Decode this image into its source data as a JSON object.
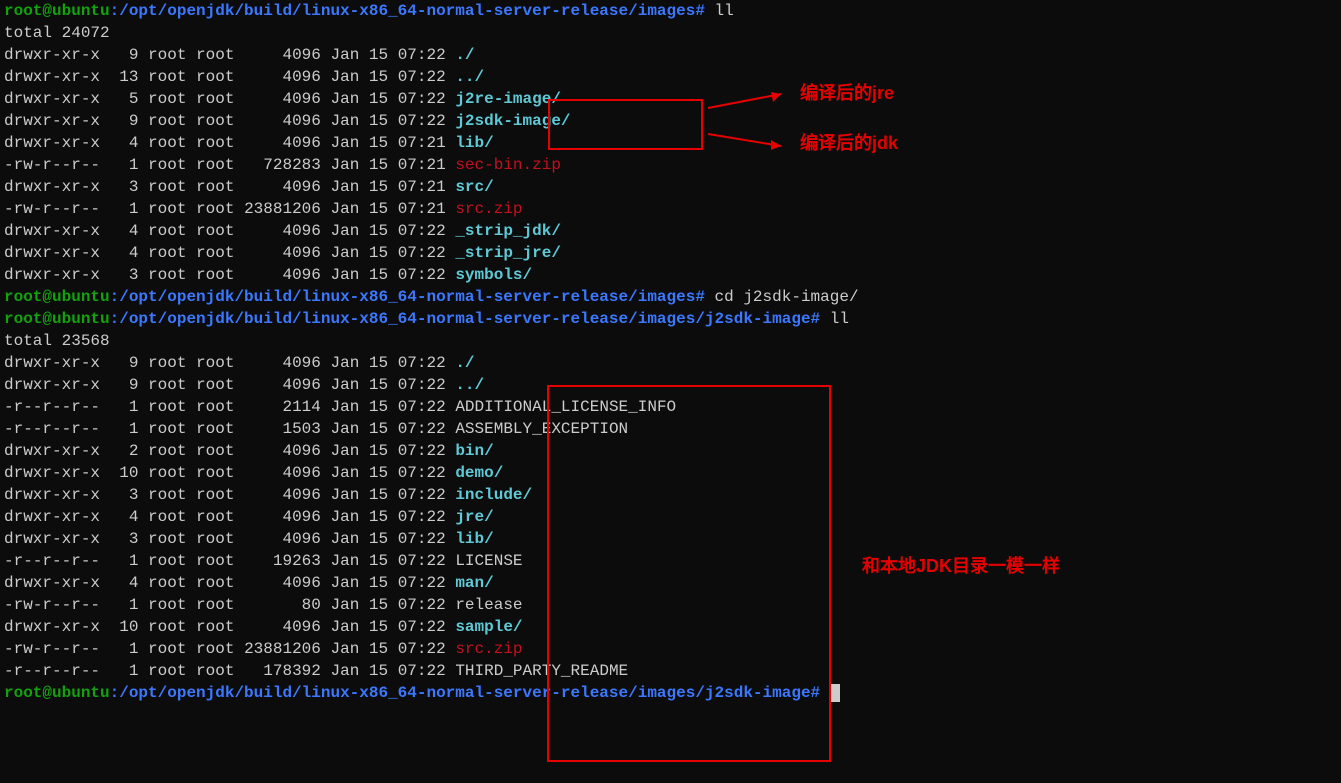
{
  "prompt1_user": "root@ubuntu",
  "prompt1_path": ":/opt/openjdk/build/linux-x86_64-normal-server-release/images#",
  "cmd1": " ll",
  "total1": "total 24072",
  "ls1": [
    {
      "perm": "drwxr-xr-x",
      "lnk": "  9",
      "own": "root",
      "grp": "root",
      "size": "    4096",
      "date": "Jan 15 07:22",
      "name": "./",
      "cls": "cyan bold"
    },
    {
      "perm": "drwxr-xr-x",
      "lnk": " 13",
      "own": "root",
      "grp": "root",
      "size": "    4096",
      "date": "Jan 15 07:22",
      "name": "../",
      "cls": "cyan bold"
    },
    {
      "perm": "drwxr-xr-x",
      "lnk": "  5",
      "own": "root",
      "grp": "root",
      "size": "    4096",
      "date": "Jan 15 07:22",
      "name": "j2re-image/",
      "cls": "cyan bold"
    },
    {
      "perm": "drwxr-xr-x",
      "lnk": "  9",
      "own": "root",
      "grp": "root",
      "size": "    4096",
      "date": "Jan 15 07:22",
      "name": "j2sdk-image/",
      "cls": "cyan bold"
    },
    {
      "perm": "drwxr-xr-x",
      "lnk": "  4",
      "own": "root",
      "grp": "root",
      "size": "    4096",
      "date": "Jan 15 07:21",
      "name": "lib/",
      "cls": "cyan bold"
    },
    {
      "perm": "-rw-r--r--",
      "lnk": "  1",
      "own": "root",
      "grp": "root",
      "size": "  728283",
      "date": "Jan 15 07:21",
      "name": "sec-bin.zip",
      "cls": "red-f"
    },
    {
      "perm": "drwxr-xr-x",
      "lnk": "  3",
      "own": "root",
      "grp": "root",
      "size": "    4096",
      "date": "Jan 15 07:21",
      "name": "src/",
      "cls": "cyan bold"
    },
    {
      "perm": "-rw-r--r--",
      "lnk": "  1",
      "own": "root",
      "grp": "root",
      "size": "23881206",
      "date": "Jan 15 07:21",
      "name": "src.zip",
      "cls": "red-f"
    },
    {
      "perm": "drwxr-xr-x",
      "lnk": "  4",
      "own": "root",
      "grp": "root",
      "size": "    4096",
      "date": "Jan 15 07:22",
      "name": "_strip_jdk/",
      "cls": "cyan bold"
    },
    {
      "perm": "drwxr-xr-x",
      "lnk": "  4",
      "own": "root",
      "grp": "root",
      "size": "    4096",
      "date": "Jan 15 07:22",
      "name": "_strip_jre/",
      "cls": "cyan bold"
    },
    {
      "perm": "drwxr-xr-x",
      "lnk": "  3",
      "own": "root",
      "grp": "root",
      "size": "    4096",
      "date": "Jan 15 07:22",
      "name": "symbols/",
      "cls": "cyan bold"
    }
  ],
  "prompt2_user": "root@ubuntu",
  "prompt2_path": ":/opt/openjdk/build/linux-x86_64-normal-server-release/images#",
  "cmd2": " cd j2sdk-image/",
  "prompt3_user": "root@ubuntu",
  "prompt3_path": ":/opt/openjdk/build/linux-x86_64-normal-server-release/images/j2sdk-image#",
  "cmd3": " ll",
  "total2": "total 23568",
  "ls2": [
    {
      "perm": "drwxr-xr-x",
      "lnk": "  9",
      "own": "root",
      "grp": "root",
      "size": "    4096",
      "date": "Jan 15 07:22",
      "name": "./",
      "cls": "cyan bold"
    },
    {
      "perm": "drwxr-xr-x",
      "lnk": "  9",
      "own": "root",
      "grp": "root",
      "size": "    4096",
      "date": "Jan 15 07:22",
      "name": "../",
      "cls": "cyan bold"
    },
    {
      "perm": "-r--r--r--",
      "lnk": "  1",
      "own": "root",
      "grp": "root",
      "size": "    2114",
      "date": "Jan 15 07:22",
      "name": "ADDITIONAL_LICENSE_INFO",
      "cls": "white"
    },
    {
      "perm": "-r--r--r--",
      "lnk": "  1",
      "own": "root",
      "grp": "root",
      "size": "    1503",
      "date": "Jan 15 07:22",
      "name": "ASSEMBLY_EXCEPTION",
      "cls": "white"
    },
    {
      "perm": "drwxr-xr-x",
      "lnk": "  2",
      "own": "root",
      "grp": "root",
      "size": "    4096",
      "date": "Jan 15 07:22",
      "name": "bin/",
      "cls": "cyan bold"
    },
    {
      "perm": "drwxr-xr-x",
      "lnk": " 10",
      "own": "root",
      "grp": "root",
      "size": "    4096",
      "date": "Jan 15 07:22",
      "name": "demo/",
      "cls": "cyan bold"
    },
    {
      "perm": "drwxr-xr-x",
      "lnk": "  3",
      "own": "root",
      "grp": "root",
      "size": "    4096",
      "date": "Jan 15 07:22",
      "name": "include/",
      "cls": "cyan bold"
    },
    {
      "perm": "drwxr-xr-x",
      "lnk": "  4",
      "own": "root",
      "grp": "root",
      "size": "    4096",
      "date": "Jan 15 07:22",
      "name": "jre/",
      "cls": "cyan bold"
    },
    {
      "perm": "drwxr-xr-x",
      "lnk": "  3",
      "own": "root",
      "grp": "root",
      "size": "    4096",
      "date": "Jan 15 07:22",
      "name": "lib/",
      "cls": "cyan bold"
    },
    {
      "perm": "-r--r--r--",
      "lnk": "  1",
      "own": "root",
      "grp": "root",
      "size": "   19263",
      "date": "Jan 15 07:22",
      "name": "LICENSE",
      "cls": "white"
    },
    {
      "perm": "drwxr-xr-x",
      "lnk": "  4",
      "own": "root",
      "grp": "root",
      "size": "    4096",
      "date": "Jan 15 07:22",
      "name": "man/",
      "cls": "cyan bold"
    },
    {
      "perm": "-rw-r--r--",
      "lnk": "  1",
      "own": "root",
      "grp": "root",
      "size": "      80",
      "date": "Jan 15 07:22",
      "name": "release",
      "cls": "white"
    },
    {
      "perm": "drwxr-xr-x",
      "lnk": " 10",
      "own": "root",
      "grp": "root",
      "size": "    4096",
      "date": "Jan 15 07:22",
      "name": "sample/",
      "cls": "cyan bold"
    },
    {
      "perm": "-rw-r--r--",
      "lnk": "  1",
      "own": "root",
      "grp": "root",
      "size": "23881206",
      "date": "Jan 15 07:22",
      "name": "src.zip",
      "cls": "red-f"
    },
    {
      "perm": "-r--r--r--",
      "lnk": "  1",
      "own": "root",
      "grp": "root",
      "size": "  178392",
      "date": "Jan 15 07:22",
      "name": "THIRD_PARTY_README",
      "cls": "white"
    }
  ],
  "prompt4_user": "root@ubuntu",
  "prompt4_path": ":/opt/openjdk/build/linux-x86_64-normal-server-release/images/j2sdk-image#",
  "anno_jre": "编译后的jre",
  "anno_jdk": "编译后的jdk",
  "anno_same": "和本地JDK目录一模一样"
}
